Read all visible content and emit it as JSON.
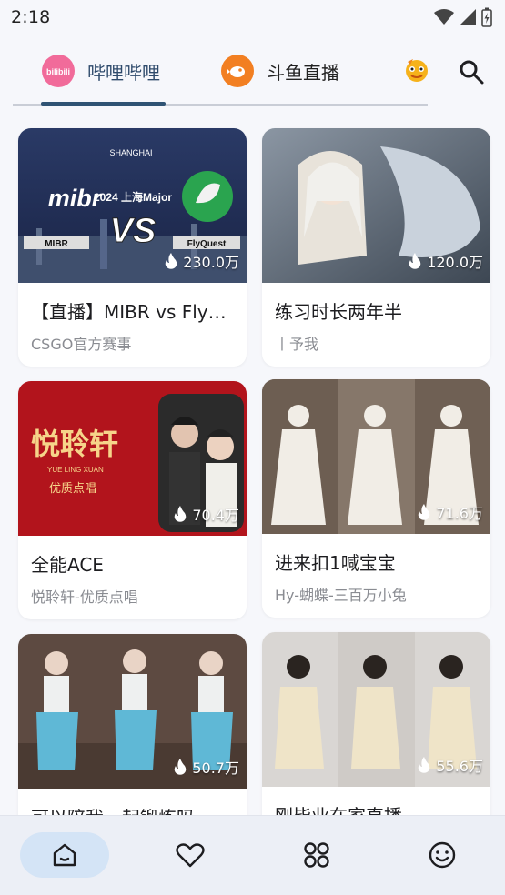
{
  "status": {
    "time": "2:18"
  },
  "tabs": [
    {
      "label": "哔哩哔哩",
      "logo_text": "bilibili",
      "active": true
    },
    {
      "label": "斗鱼直播",
      "active": false
    }
  ],
  "colors": {
    "active_tab": "#2f5374",
    "nav_active_bg": "#d4e4f6"
  },
  "cards": [
    {
      "title": "【直播】MIBR vs FlyQuest",
      "subtitle": "CSGO官方赛事",
      "viewers": "230.0万",
      "thumb": {
        "left_team": "MIBR",
        "right_team": "FlyQuest",
        "vs": "VS",
        "left_logo": "mibr",
        "event": "2024 上海Major",
        "brand": "SHANGHAI"
      }
    },
    {
      "title": "练习时长两年半",
      "subtitle": "丨予我",
      "viewers": "120.0万"
    },
    {
      "title": "全能ACE",
      "subtitle": "悦聆轩-优质点唱",
      "viewers": "70.4万",
      "thumb": {
        "big": "悦聆轩",
        "small": "YUE LING XUAN",
        "tag": "优质点唱"
      }
    },
    {
      "title": "进来扣1喊宝宝",
      "subtitle": "Hy-蝴蝶-三百万小兔",
      "viewers": "71.6万"
    },
    {
      "title": "可以陪我一起锻炼吗~",
      "subtitle": "",
      "viewers": "50.7万"
    },
    {
      "title": "刚毕业在家直播",
      "subtitle": "",
      "viewers": "55.6万"
    }
  ],
  "nav": [
    {
      "icon": "home-icon",
      "active": true
    },
    {
      "icon": "heart-icon",
      "active": false
    },
    {
      "icon": "apps-icon",
      "active": false
    },
    {
      "icon": "smile-icon",
      "active": false
    }
  ]
}
